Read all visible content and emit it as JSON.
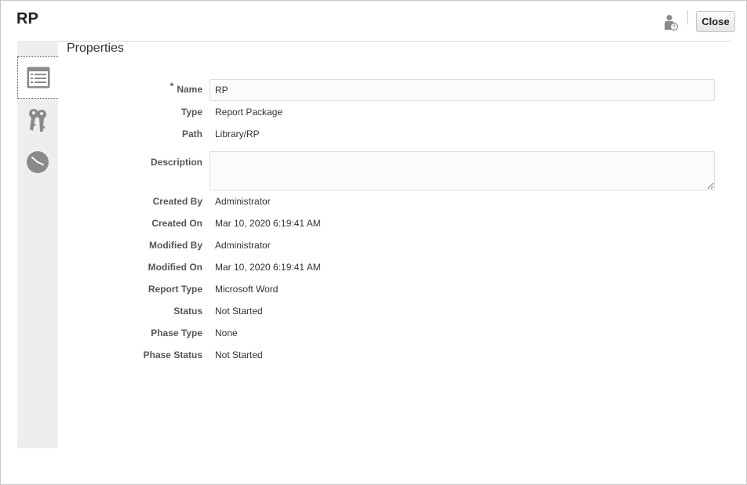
{
  "dialog": {
    "title": "RP",
    "close_label": "Close"
  },
  "sidebar": {
    "tabs": [
      {
        "name": "properties",
        "icon": "properties-list-icon",
        "active": true
      },
      {
        "name": "access",
        "icon": "keys-icon",
        "active": false
      },
      {
        "name": "history",
        "icon": "clock-icon",
        "active": false
      }
    ]
  },
  "properties": {
    "section_title": "Properties",
    "required_marker": "*",
    "name_label": "Name",
    "name_value": "RP",
    "type_label": "Type",
    "type_value": "Report Package",
    "path_label": "Path",
    "path_value": "Library/RP",
    "description_label": "Description",
    "description_value": "",
    "created_by_label": "Created By",
    "created_by_value": "Administrator",
    "created_on_label": "Created On",
    "created_on_value": "Mar 10, 2020 6:19:41 AM",
    "modified_by_label": "Modified By",
    "modified_by_value": "Administrator",
    "modified_on_label": "Modified On",
    "modified_on_value": "Mar 10, 2020 6:19:41 AM",
    "report_type_label": "Report Type",
    "report_type_value": "Microsoft Word",
    "status_label": "Status",
    "status_value": "Not Started",
    "phase_type_label": "Phase Type",
    "phase_type_value": "None",
    "phase_status_label": "Phase Status",
    "phase_status_value": "Not Started"
  },
  "colors": {
    "sidebar_bg": "#eeeeee",
    "icon_gray": "#8a8a8a",
    "input_border": "#dcdcdc"
  }
}
